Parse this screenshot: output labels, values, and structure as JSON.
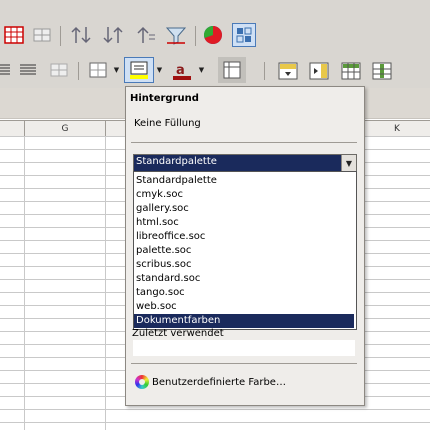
{
  "toolbar1": {
    "icons": [
      "table-red-icon",
      "insert-table-icon",
      "sort-ascending-icon",
      "sort-descending-icon",
      "sort-icon",
      "autofilter-icon",
      "chart-icon",
      "pivot-table-icon"
    ]
  },
  "toolbar2": {
    "icons": [
      "align-justify-icon",
      "align-distributed-icon",
      "merge-cells-icon",
      "borders-icon",
      "background-color-icon",
      "font-color-icon",
      "conditional-icon",
      "insert-cells-icon",
      "freeze-icon",
      "split-icon"
    ]
  },
  "sheet": {
    "columns": [
      "G",
      "K"
    ]
  },
  "popup": {
    "title": "Hintergrund",
    "no_fill": "Keine Füllung",
    "palette_selected": "Standardpalette",
    "palettes": [
      "Standardpalette",
      "cmyk.soc",
      "gallery.soc",
      "html.soc",
      "libreoffice.soc",
      "palette.soc",
      "scribus.soc",
      "standard.soc",
      "tango.soc",
      "web.soc",
      "Dokumentfarben"
    ],
    "highlighted_palette": "Dokumentfarben",
    "recently_used": "Zuletzt verwendet",
    "custom_color": "Benutzerdefinierte Farbe…"
  },
  "colors": {
    "selection": "#1a2a5c",
    "toolbar_bg": "#d9d6d1",
    "popup_bg": "#efedea"
  }
}
